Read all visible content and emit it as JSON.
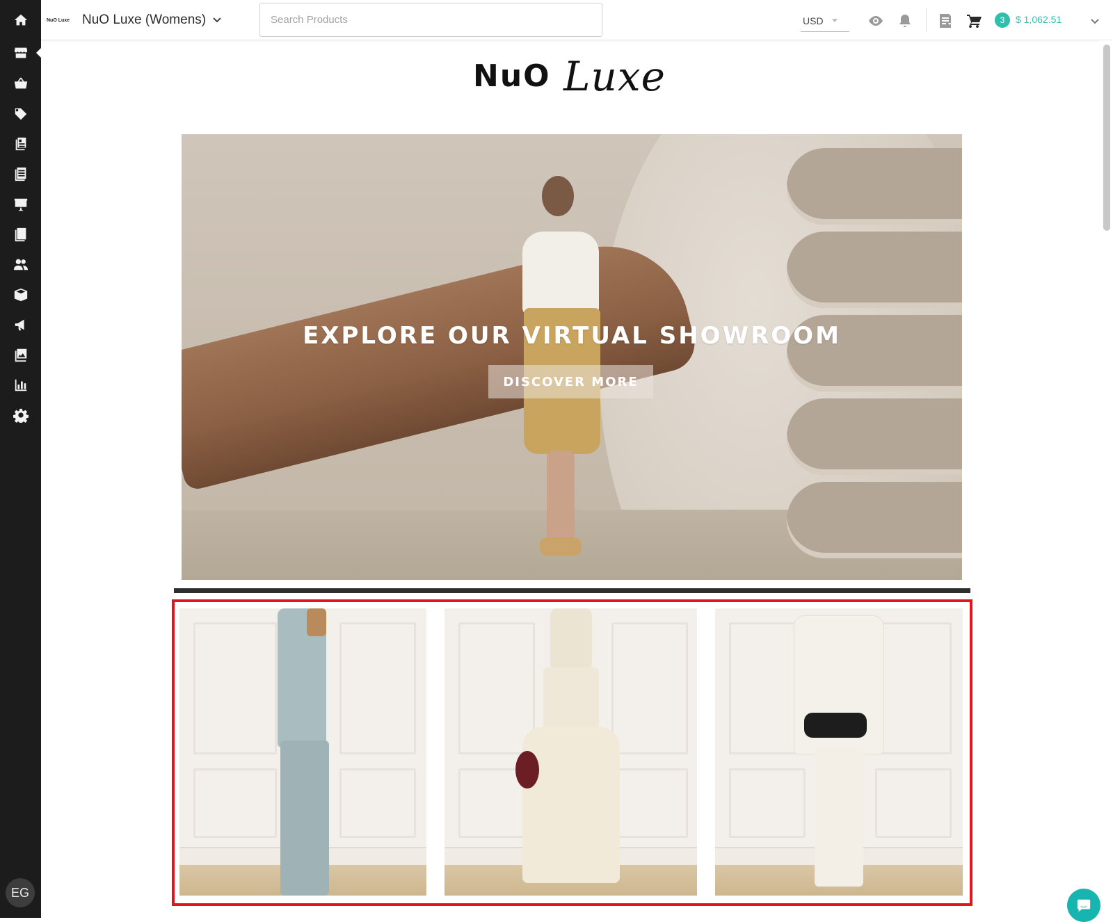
{
  "sidebar": {
    "items": [
      {
        "name": "home-icon"
      },
      {
        "name": "storefront-icon"
      },
      {
        "name": "basket-icon"
      },
      {
        "name": "tag-icon"
      },
      {
        "name": "catalog-icon"
      },
      {
        "name": "book-icon"
      },
      {
        "name": "presentation-icon"
      },
      {
        "name": "checklist-icon"
      },
      {
        "name": "users-icon"
      },
      {
        "name": "box-icon"
      },
      {
        "name": "megaphone-icon"
      },
      {
        "name": "images-icon"
      },
      {
        "name": "bar-chart-icon"
      },
      {
        "name": "gear-icon"
      }
    ],
    "avatar_initials": "EG"
  },
  "topbar": {
    "brand_mini": "NuO Luxe",
    "store_name": "NuO Luxe (Womens)",
    "search_placeholder": "Search Products",
    "currency": "USD",
    "cart_count": "3",
    "cart_total": "$ 1,062.51"
  },
  "content": {
    "logo_primary": "NuO",
    "logo_script": "Luxe",
    "hero": {
      "title": "EXPLORE OUR VIRTUAL SHOWROOM",
      "button_label": "DISCOVER MORE"
    },
    "products": [
      {
        "name": "light-blue-suit-look"
      },
      {
        "name": "cream-maxi-dress-look"
      },
      {
        "name": "white-suit-look"
      }
    ]
  },
  "colors": {
    "sidebar_bg": "#1c1c1c",
    "accent_teal": "#2fbfac",
    "highlight_red": "#e3141b",
    "divider_dark": "#2e2e2e"
  }
}
